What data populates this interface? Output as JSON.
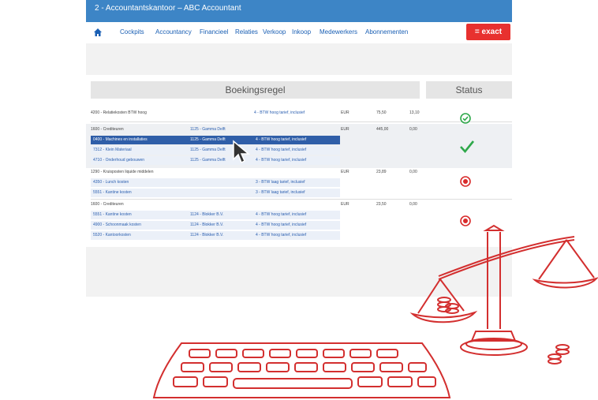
{
  "window": {
    "title": "2 - Accountantskantoor – ABC Accountant"
  },
  "nav": {
    "home_icon": "home-icon",
    "items": [
      "Cockpits",
      "Accountancy",
      "Financieel",
      "Relaties",
      "Verkoop",
      "Inkoop",
      "Medewerkers",
      "Abonnementen"
    ],
    "logo": "= exact"
  },
  "table": {
    "headers": {
      "booking": "Boekingsregel",
      "status": "Status"
    },
    "rows": [
      {
        "account": "4200 - Relatiekosten BTW hoog",
        "relation": "",
        "vat": "4 - BTW hoog tarief, inclusief",
        "currency": "EUR",
        "amount": "75,50",
        "vatamount": "13,10"
      },
      {
        "account": "1600 - Crediteuren",
        "relation": "1125 - Gamma Delft",
        "vat": "",
        "currency": "EUR",
        "amount": "445,00",
        "vatamount": "0,00"
      },
      {
        "account": "0400 - Machines en installaties",
        "relation": "1125 - Gamma Delft",
        "vat": "4 - BTW hoog tarief, inclusief"
      },
      {
        "account": "7312 - Klein Materiaal",
        "relation": "1125 - Gamma Delft",
        "vat": "4 - BTW hoog tarief, inclusief"
      },
      {
        "account": "4710 - Onderhoud gebouwen",
        "relation": "1125 - Gamma Delft",
        "vat": "4 - BTW hoog tarief, inclusief"
      },
      {
        "account": "1290 - Kruisposten liquide middelen",
        "relation": "",
        "vat": "",
        "currency": "EUR",
        "amount": "23,89",
        "vatamount": "0,00"
      },
      {
        "account": "4350 - Lunch kosten",
        "relation": "",
        "vat": "3 - BTW laag tarief, inclusief"
      },
      {
        "account": "5551 - Kantine kosten",
        "relation": "",
        "vat": "3 - BTW laag tarief, inclusief"
      },
      {
        "account": "1600 - Crediteuren",
        "relation": "",
        "vat": "",
        "currency": "EUR",
        "amount": "23,50",
        "vatamount": "0,00"
      },
      {
        "account": "5551 - Kantine kosten",
        "relation": "1124 - Blokker B.V.",
        "vat": "4 - BTW hoog tarief, inclusief"
      },
      {
        "account": "4900 - Schoonmaak kosten",
        "relation": "1124 - Blokker B.V.",
        "vat": "4 - BTW hoog tarief, inclusief"
      },
      {
        "account": "5520 - Kantoorkosten",
        "relation": "1124 - Blokker B.V.",
        "vat": "4 - BTW hoog tarief, inclusief"
      }
    ]
  },
  "status_icons": [
    "check-circle-icon",
    "check-icon",
    "error-circle-icon",
    "error-circle-icon"
  ],
  "colors": {
    "accent": "#3d85c6",
    "brand": "#e8312f",
    "ok": "#2ea84a",
    "error": "#d92b2b"
  }
}
